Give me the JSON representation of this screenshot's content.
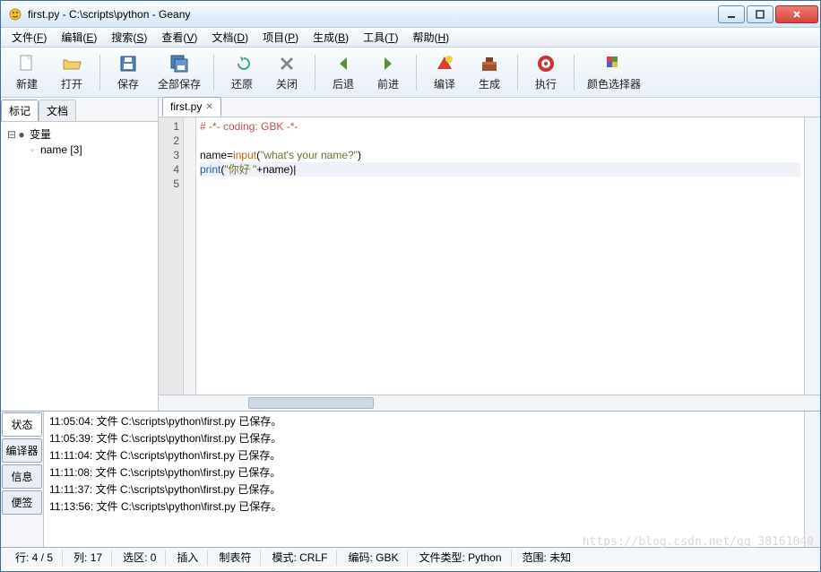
{
  "window": {
    "title": "first.py - C:\\scripts\\python - Geany"
  },
  "menus": [
    "文件(F)",
    "编辑(E)",
    "搜索(S)",
    "查看(V)",
    "文档(D)",
    "项目(P)",
    "生成(B)",
    "工具(T)",
    "帮助(H)"
  ],
  "toolbar": [
    {
      "label": "新建",
      "icon": "file-new"
    },
    {
      "label": "打开",
      "icon": "folder-open"
    },
    {
      "sep": true
    },
    {
      "label": "保存",
      "icon": "save"
    },
    {
      "label": "全部保存",
      "icon": "save-all"
    },
    {
      "sep": true
    },
    {
      "label": "还原",
      "icon": "undo"
    },
    {
      "label": "关闭",
      "icon": "close-x"
    },
    {
      "sep": true
    },
    {
      "label": "后退",
      "icon": "arrow-left"
    },
    {
      "label": "前进",
      "icon": "arrow-right"
    },
    {
      "sep": true
    },
    {
      "label": "编译",
      "icon": "compile"
    },
    {
      "label": "生成",
      "icon": "build"
    },
    {
      "sep": true
    },
    {
      "label": "执行",
      "icon": "execute"
    },
    {
      "sep": true
    },
    {
      "label": "颜色选择器",
      "icon": "color-picker"
    }
  ],
  "sidebar": {
    "tabs": [
      "标记",
      "文档"
    ],
    "active_tab": 0,
    "tree": {
      "root_label": "变量",
      "children": [
        {
          "label": "name [3]"
        }
      ]
    }
  },
  "editor": {
    "tab_label": "first.py",
    "lines": [
      {
        "n": 1,
        "tokens": [
          {
            "t": "# -*- coding: GBK -*-",
            "c": "c-comment"
          }
        ]
      },
      {
        "n": 2,
        "tokens": []
      },
      {
        "n": 3,
        "tokens": [
          {
            "t": "name=",
            "c": ""
          },
          {
            "t": "input",
            "c": "c-func"
          },
          {
            "t": "(",
            "c": ""
          },
          {
            "t": "\"what's your name?\"",
            "c": "c-str"
          },
          {
            "t": ")",
            "c": ""
          }
        ]
      },
      {
        "n": 4,
        "hl": true,
        "tokens": [
          {
            "t": "print",
            "c": "c-kw"
          },
          {
            "t": "(",
            "c": ""
          },
          {
            "t": "\"你好 \"",
            "c": "c-str"
          },
          {
            "t": "+name)",
            "c": ""
          }
        ]
      },
      {
        "n": 5,
        "tokens": []
      }
    ]
  },
  "output": {
    "tabs": [
      "状态",
      "编译器",
      "信息",
      "便签"
    ],
    "active_tab": 0,
    "messages": [
      "11:05:04: 文件 C:\\scripts\\python\\first.py 已保存。",
      "11:05:39: 文件 C:\\scripts\\python\\first.py 已保存。",
      "11:11:04: 文件 C:\\scripts\\python\\first.py 已保存。",
      "11:11:08: 文件 C:\\scripts\\python\\first.py 已保存。",
      "11:11:37: 文件 C:\\scripts\\python\\first.py 已保存。",
      "11:13:56: 文件 C:\\scripts\\python\\first.py 已保存。"
    ]
  },
  "statusbar": {
    "line": "行: 4 / 5",
    "col": "列: 17",
    "sel": "选区: 0",
    "ins": "插入",
    "tab": "制表符",
    "mode": "模式: CRLF",
    "enc": "编码: GBK",
    "ftype": "文件类型: Python",
    "scope": "范围: 未知"
  },
  "watermark": "https://blog.csdn.net/qq_38161040"
}
